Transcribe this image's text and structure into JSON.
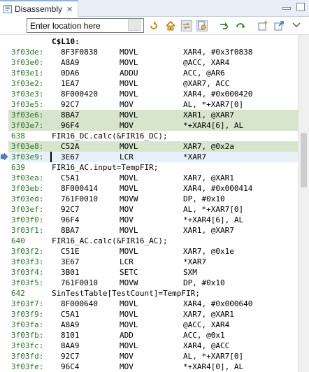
{
  "tab": {
    "title": "Disassembly",
    "icon": "disassembly-icon",
    "close_icon": "close-icon"
  },
  "toolbar": {
    "location_placeholder": "Enter location here",
    "icons": [
      "go-to-location-icon",
      "refresh-icon",
      "home-icon",
      "link-with-editor-icon",
      "sync-icon",
      "step-icon",
      "restart-icon",
      "new-view-icon",
      "open-external-icon",
      "view-menu-icon"
    ]
  },
  "rows": [
    {
      "type": "label",
      "text": "C$L10:"
    },
    {
      "type": "asm",
      "addr": "3f03de:",
      "op": "8F3F0838",
      "mn": "MOVL",
      "args": "XAR4, #0x3f0838"
    },
    {
      "type": "asm",
      "addr": "3f03e0:",
      "op": "A8A9",
      "mn": "MOVL",
      "args": "@ACC, XAR4"
    },
    {
      "type": "asm",
      "addr": "3f03e1:",
      "op": "0DA6",
      "mn": "ADDU",
      "args": "ACC, @AR6"
    },
    {
      "type": "asm",
      "addr": "3f03e2:",
      "op": "1EA7",
      "mn": "MOVL",
      "args": "@XAR7, ACC"
    },
    {
      "type": "asm",
      "addr": "3f03e3:",
      "op": "8F000420",
      "mn": "MOVL",
      "args": "XAR4, #0x000420"
    },
    {
      "type": "asm",
      "addr": "3f03e5:",
      "op": "92C7",
      "mn": "MOV",
      "args": "AL, *+XAR7[0]"
    },
    {
      "type": "asm",
      "addr": "3f03e6:",
      "op": "8BA7",
      "mn": "MOVL",
      "args": "XAR1, @XAR7",
      "hl": true
    },
    {
      "type": "asm",
      "addr": "3f03e7:",
      "op": "96F4",
      "mn": "MOV",
      "args": "*+XAR4[6], AL",
      "hl": true
    },
    {
      "type": "src",
      "ln": "638",
      "text": "FIR16_DC.calc(&FIR16_DC);"
    },
    {
      "type": "asm",
      "addr": "3f03e8:",
      "op": "C52A",
      "mn": "MOVL",
      "args": "XAR7, @0x2a",
      "hl": true
    },
    {
      "type": "asm",
      "addr": "3f03e9:",
      "op": "3E67",
      "mn": "LCR",
      "args": "*XAR7",
      "hl": true,
      "cur": true,
      "pc": true
    },
    {
      "type": "src",
      "ln": "639",
      "text": "FIR16_AC.input=TempFIR;"
    },
    {
      "type": "asm",
      "addr": "3f03ea:",
      "op": "C5A1",
      "mn": "MOVL",
      "args": "XAR7, @XAR1"
    },
    {
      "type": "asm",
      "addr": "3f03eb:",
      "op": "8F000414",
      "mn": "MOVL",
      "args": "XAR4, #0x000414"
    },
    {
      "type": "asm",
      "addr": "3f03ed:",
      "op": "761F0010",
      "mn": "MOVW",
      "args": "DP, #0x10"
    },
    {
      "type": "asm",
      "addr": "3f03ef:",
      "op": "92C7",
      "mn": "MOV",
      "args": "AL, *+XAR7[0]"
    },
    {
      "type": "asm",
      "addr": "3f03f0:",
      "op": "96F4",
      "mn": "MOV",
      "args": "*+XAR4[6], AL"
    },
    {
      "type": "asm",
      "addr": "3f03f1:",
      "op": "8BA7",
      "mn": "MOVL",
      "args": "XAR1, @XAR7"
    },
    {
      "type": "src",
      "ln": "640",
      "text": "FIR16_AC.calc(&FIR16_AC);"
    },
    {
      "type": "asm",
      "addr": "3f03f2:",
      "op": "C51E",
      "mn": "MOVL",
      "args": "XAR7, @0x1e"
    },
    {
      "type": "asm",
      "addr": "3f03f3:",
      "op": "3E67",
      "mn": "LCR",
      "args": "*XAR7"
    },
    {
      "type": "asm",
      "addr": "3f03f4:",
      "op": "3B01",
      "mn": "SETC",
      "args": "SXM"
    },
    {
      "type": "asm",
      "addr": "3f03f5:",
      "op": "761F0010",
      "mn": "MOVW",
      "args": "DP, #0x10"
    },
    {
      "type": "src",
      "ln": "642",
      "text": "SinTestTable[TestCount]=TempFIR;"
    },
    {
      "type": "asm",
      "addr": "3f03f7:",
      "op": "8F000640",
      "mn": "MOVL",
      "args": "XAR4, #0x000640"
    },
    {
      "type": "asm",
      "addr": "3f03f9:",
      "op": "C5A1",
      "mn": "MOVL",
      "args": "XAR7, @XAR1"
    },
    {
      "type": "asm",
      "addr": "3f03fa:",
      "op": "A8A9",
      "mn": "MOVL",
      "args": "@ACC, XAR4"
    },
    {
      "type": "asm",
      "addr": "3f03fb:",
      "op": "8101",
      "mn": "ADD",
      "args": "ACC, @0x1"
    },
    {
      "type": "asm",
      "addr": "3f03fc:",
      "op": "8AA9",
      "mn": "MOVL",
      "args": "XAR4, @ACC"
    },
    {
      "type": "asm",
      "addr": "3f03fd:",
      "op": "92C7",
      "mn": "MOV",
      "args": "AL, *+XAR7[0]"
    },
    {
      "type": "asm",
      "addr": "3f03fe:",
      "op": "96C4",
      "mn": "MOV",
      "args": "*+XAR4[0], AL"
    }
  ]
}
